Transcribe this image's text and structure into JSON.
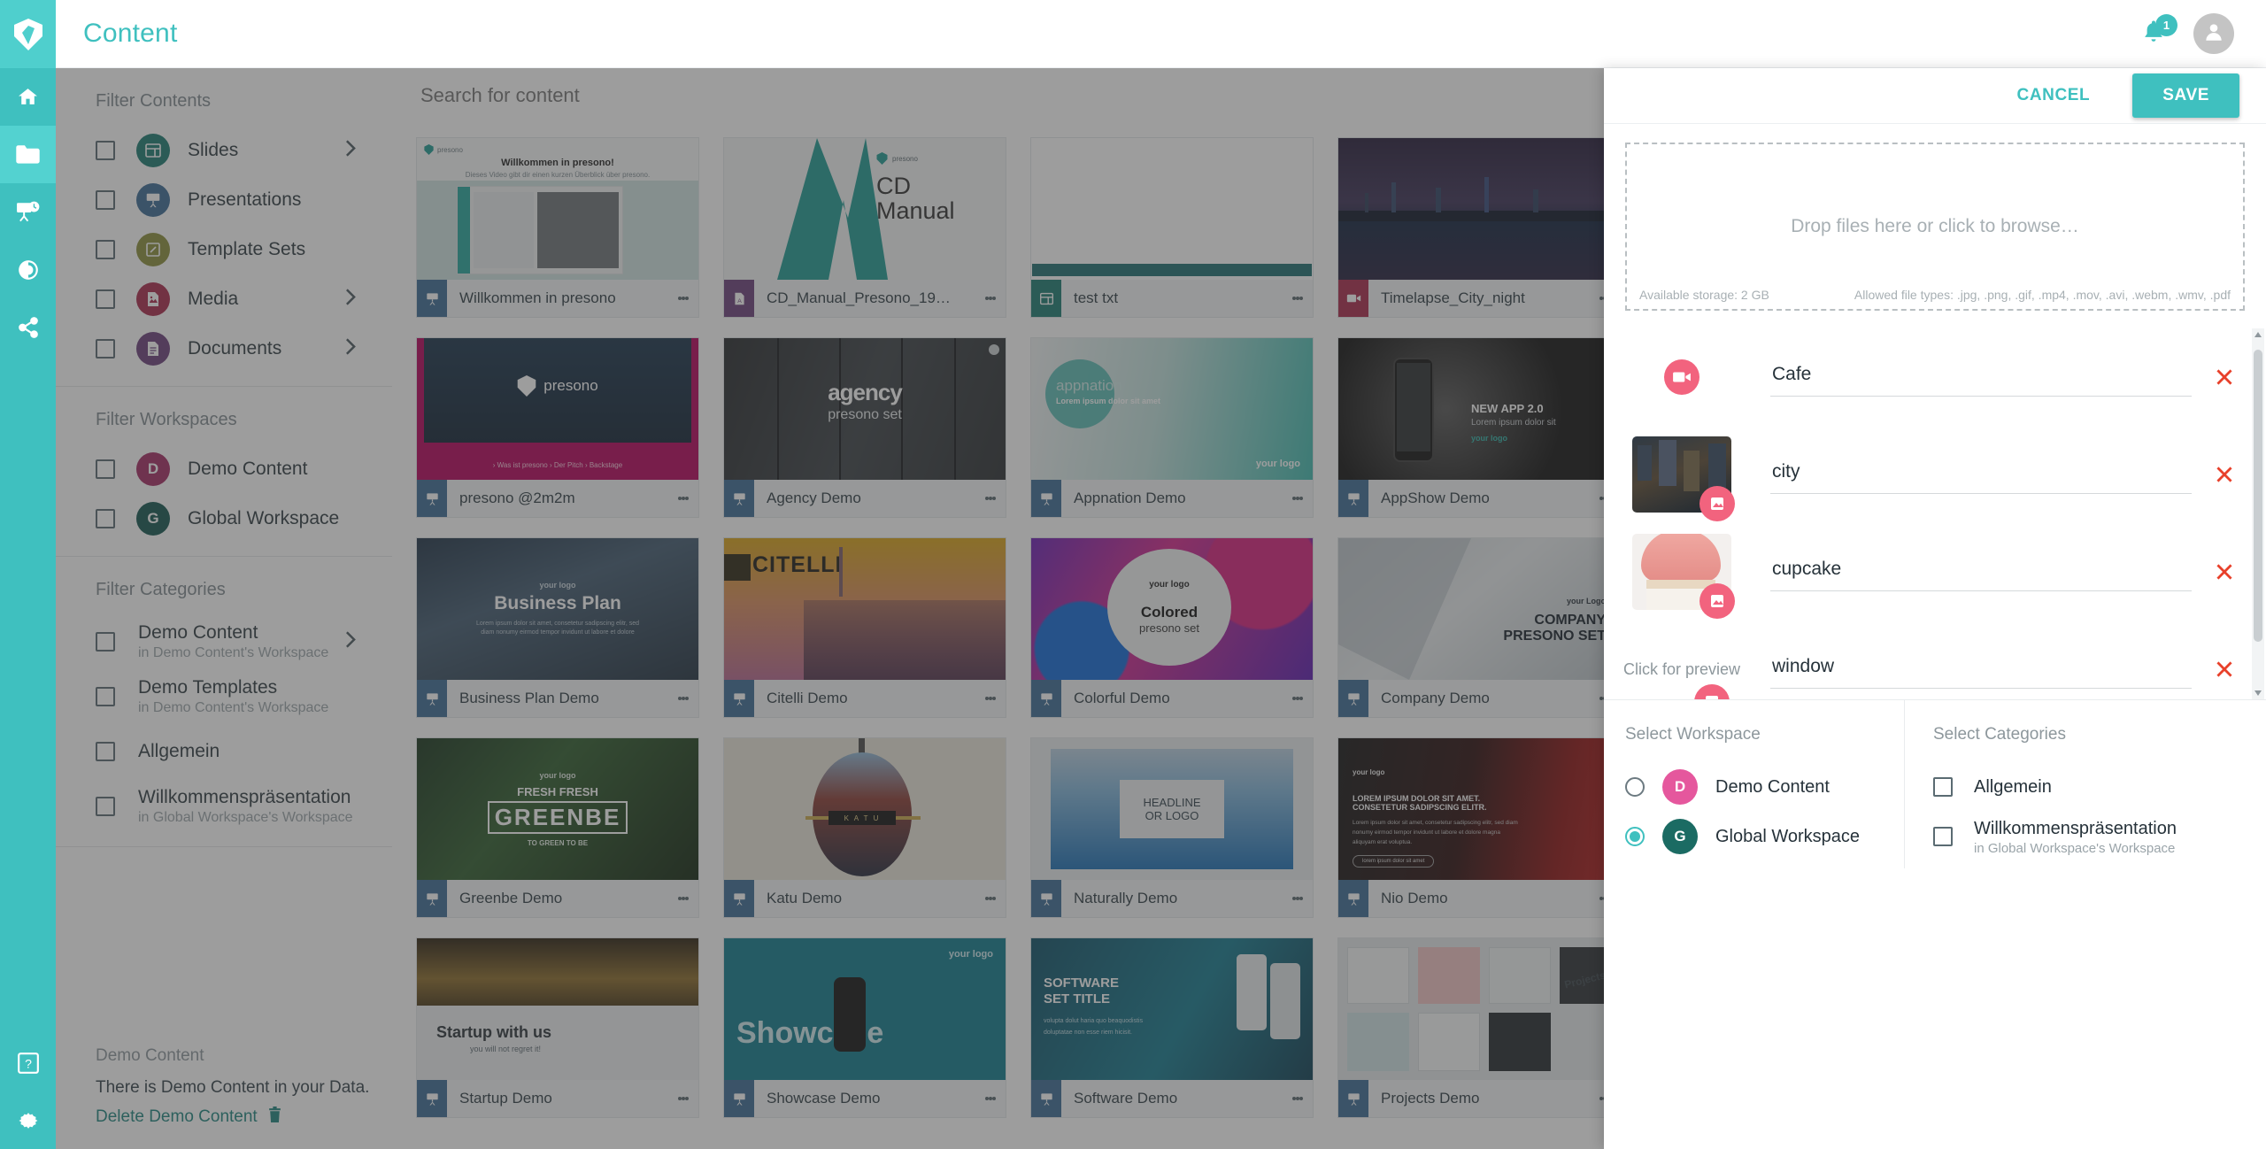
{
  "header": {
    "title": "Content",
    "notification_count": "1",
    "bell_icon": "bell-icon",
    "avatar_icon": "user-avatar-icon"
  },
  "rail": {
    "logo_icon": "presono-logo-icon",
    "items": [
      {
        "icon": "home-icon",
        "name": "home",
        "active": false
      },
      {
        "icon": "folder-icon",
        "name": "content",
        "active": true
      },
      {
        "icon": "presentation-icon",
        "name": "present",
        "active": false
      },
      {
        "icon": "analytics-icon",
        "name": "analytics",
        "active": false
      },
      {
        "icon": "share-icon",
        "name": "share",
        "active": false
      }
    ],
    "bottom_items": [
      {
        "icon": "help-icon",
        "name": "help"
      },
      {
        "icon": "settings-icon",
        "name": "settings"
      }
    ]
  },
  "sidebar": {
    "contents_head": "Filter Contents",
    "contents": [
      {
        "label": "Slides",
        "color": "#1b7a70",
        "icon": "slides-icon",
        "chevron": true
      },
      {
        "label": "Presentations",
        "color": "#3b6a94",
        "icon": "presentation-icon",
        "chevron": false
      },
      {
        "label": "Template Sets",
        "color": "#8b8f3a",
        "icon": "template-icon",
        "chevron": false
      },
      {
        "label": "Media",
        "color": "#a8294a",
        "icon": "media-icon",
        "chevron": true
      },
      {
        "label": "Documents",
        "color": "#6a3f7a",
        "icon": "document-icon",
        "chevron": true
      }
    ],
    "workspaces_head": "Filter Workspaces",
    "workspaces": [
      {
        "label": "Demo Content",
        "initial": "D",
        "color": "#a22a62"
      },
      {
        "label": "Global Workspace",
        "initial": "G",
        "color": "#12554f"
      }
    ],
    "categories_head": "Filter Categories",
    "categories": [
      {
        "title": "Demo Content",
        "sub": "in Demo Content's Workspace",
        "chevron": true
      },
      {
        "title": "Demo Templates",
        "sub": "in Demo Content's Workspace",
        "chevron": false
      },
      {
        "title": "Allgemein",
        "sub": "",
        "chevron": false
      },
      {
        "title": "Willkommenspräsentation",
        "sub": "in Global Workspace's Workspace",
        "chevron": false
      }
    ],
    "demo_box": {
      "head": "Demo Content",
      "line": "There is Demo Content in your Data.",
      "link": "Delete Demo Content",
      "trash_icon": "trash-icon"
    }
  },
  "main": {
    "search_placeholder": "Search for content",
    "search_value": "",
    "cards": [
      {
        "name": "Willkommen in presono",
        "type": "presentation",
        "chip": "#3b6a94",
        "art": "willkommen"
      },
      {
        "name": "CD_Manual_Presono_19…",
        "type": "document",
        "chip": "#6a3f7a",
        "art": "cdmanual"
      },
      {
        "name": "test txt",
        "type": "slide",
        "chip": "#1b7a70",
        "art": "testtxt"
      },
      {
        "name": "Timelapse_City_night",
        "type": "video",
        "chip": "#a8294a",
        "art": "timelapse"
      },
      {
        "name": "presono @2m2m",
        "type": "presentation",
        "chip": "#3b6a94",
        "art": "presono2m2m"
      },
      {
        "name": "Agency Demo",
        "type": "presentation",
        "chip": "#3b6a94",
        "art": "agency"
      },
      {
        "name": "Appnation Demo",
        "type": "presentation",
        "chip": "#3b6a94",
        "art": "appnation"
      },
      {
        "name": "AppShow Demo",
        "type": "presentation",
        "chip": "#3b6a94",
        "art": "appshow"
      },
      {
        "name": "Business Plan Demo",
        "type": "presentation",
        "chip": "#3b6a94",
        "art": "businessplan"
      },
      {
        "name": "Citelli Demo",
        "type": "presentation",
        "chip": "#3b6a94",
        "art": "citelli"
      },
      {
        "name": "Colorful Demo",
        "type": "presentation",
        "chip": "#3b6a94",
        "art": "colorful"
      },
      {
        "name": "Company Demo",
        "type": "presentation",
        "chip": "#3b6a94",
        "art": "company"
      },
      {
        "name": "Greenbe Demo",
        "type": "presentation",
        "chip": "#3b6a94",
        "art": "greenbe"
      },
      {
        "name": "Katu Demo",
        "type": "presentation",
        "chip": "#3b6a94",
        "art": "katu"
      },
      {
        "name": "Naturally Demo",
        "type": "presentation",
        "chip": "#3b6a94",
        "art": "naturally"
      },
      {
        "name": "Nio Demo",
        "type": "presentation",
        "chip": "#3b6a94",
        "art": "nio"
      },
      {
        "name": "Startup Demo",
        "type": "presentation",
        "chip": "#3b6a94",
        "art": "startup"
      },
      {
        "name": "Showcase Demo",
        "type": "presentation",
        "chip": "#3b6a94",
        "art": "showcase"
      },
      {
        "name": "Software Demo",
        "type": "presentation",
        "chip": "#3b6a94",
        "art": "software"
      },
      {
        "name": "Projects Demo",
        "type": "presentation",
        "chip": "#3b6a94",
        "art": "projects"
      }
    ],
    "card_art_text": {
      "willkommen_title": "Willkommen in presono!",
      "willkommen_sub": "Dieses Video gibt dir einen kurzen Überblick über presono.",
      "cdmanual_brand": "presono",
      "cdmanual_l1": "CD",
      "cdmanual_l2": "Manual",
      "presono2m2m_brand": "presono",
      "presono2m2m_nav": "› Was ist presono    › Der Pitch    › Backstage",
      "agency_t1": "agency",
      "agency_t2": "presono set",
      "appnation_t1": "appnation",
      "appnation_t2": "Lorem ipsum dolor sit amet",
      "appnation_logo": "your logo",
      "appshow_t1": "NEW APP 2.0",
      "appshow_t2": "Lorem ipsum dolor sit",
      "appshow_logo": "your logo",
      "businessplan_logo": "your logo",
      "businessplan_t1": "Business Plan",
      "businessplan_t2": "Lorem ipsum dolor sit amet, consetetur sadipscing elitr, sed diam nonumy eirmod tempor invidunt ut labore et dolore",
      "citelli_t1": "CITELLI",
      "colorful_logo": "your logo",
      "colorful_t1": "Colored",
      "colorful_t2": "presono set",
      "company_logo": "your Logo",
      "company_t1": "COMPANY",
      "company_t2": "PRESONO SET",
      "greenbe_logo": "your logo",
      "greenbe_t1": "FRESH FRESH",
      "greenbe_t2": "GREENBE",
      "greenbe_t3": "TO GREEN TO BE",
      "katu_t1": "K A T U",
      "naturally_t1": "HEADLINE",
      "naturally_t2": "OR LOGO",
      "nio_logo": "your logo",
      "nio_t1": "LOREM IPSUM DOLOR SIT AMET.",
      "nio_t2": "CONSETETUR SADIPSCING ELITR.",
      "nio_t3": "Lorem ipsum dolor sit amet, consetetur sadipscing elitr, sed diam nonumy eirmod tempor invidunt ut labore et dolore magna aliquyam erat voluptua.",
      "nio_btn": "lorem ipsum dolor sit amet",
      "startup_t1": "Startup with us",
      "startup_t2": "you will not regret it!",
      "showcase_logo": "your logo",
      "showcase_t1": "Showcase",
      "software_t1": "SOFTWARE",
      "software_t2": "SET TITLE",
      "software_t3": "volupta dolut haria quo beaquodistis doluptatae non esse riem hicisit.",
      "projects_t1": "Projects"
    }
  },
  "drawer": {
    "cancel_label": "CANCEL",
    "save_label": "SAVE",
    "dropzone": {
      "text": "Drop files here or click to browse…",
      "storage": "Available storage: 2 GB",
      "filetypes": "Allowed file types: .jpg, .png, .gif, .mp4, .mov, .avi, .webm, .wmv, .pdf"
    },
    "files": [
      {
        "name": "Cafe",
        "kind": "video",
        "thumb": "none",
        "badge_icon": "video-icon",
        "preview_hint": ""
      },
      {
        "name": "city",
        "kind": "image",
        "thumb": "city",
        "badge_icon": "image-icon",
        "preview_hint": ""
      },
      {
        "name": "cupcake",
        "kind": "image",
        "thumb": "cupcake",
        "badge_icon": "image-icon",
        "preview_hint": ""
      },
      {
        "name": "window",
        "kind": "image",
        "thumb": "hint",
        "badge_icon": "image-icon",
        "preview_hint": "Click for preview"
      }
    ],
    "remove_icon": "close-x-icon",
    "workspace": {
      "head": "Select Workspace",
      "options": [
        {
          "label": "Demo Content",
          "initial": "D",
          "color": "#e5579d",
          "selected": false
        },
        {
          "label": "Global Workspace",
          "initial": "G",
          "color": "#1b6b63",
          "selected": true
        }
      ]
    },
    "categories": {
      "head": "Select Categories",
      "options": [
        {
          "title": "Allgemein",
          "sub": "",
          "checked": false
        },
        {
          "title": "Willkommenspräsentation",
          "sub": "in Global Workspace's Workspace",
          "checked": false
        }
      ]
    }
  },
  "colors": {
    "accent": "#3fc0bf",
    "rail": "#3fc0bf",
    "pink": "#f2637e",
    "remove_red": "#e8402a"
  }
}
